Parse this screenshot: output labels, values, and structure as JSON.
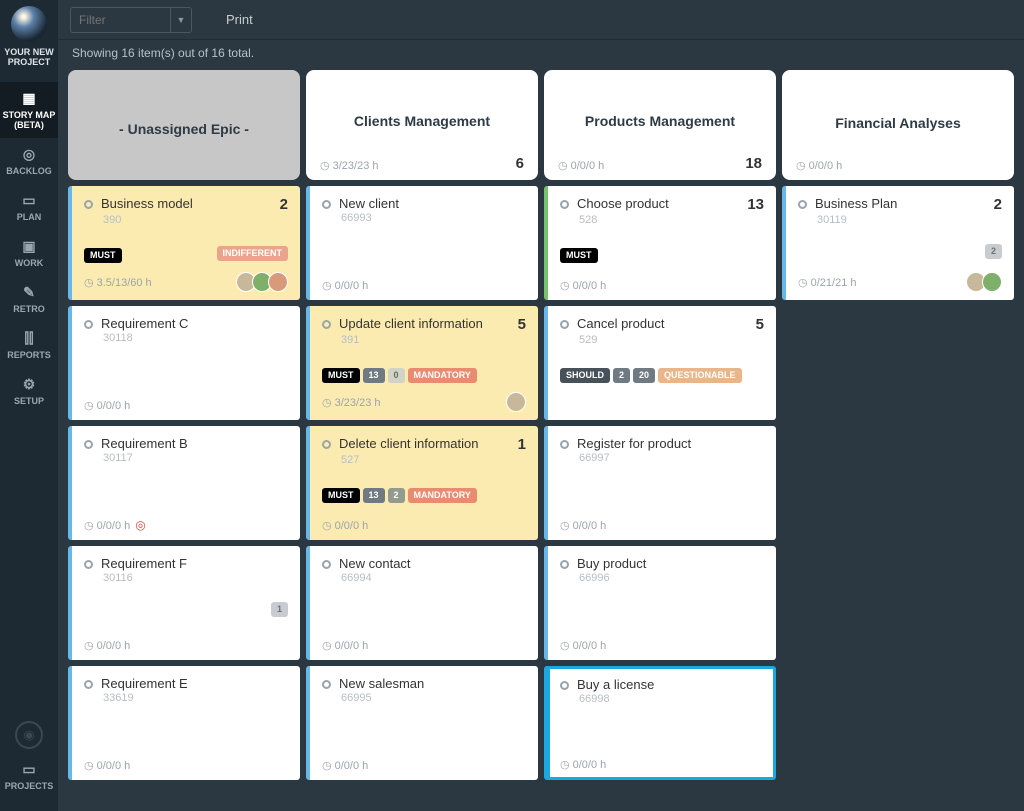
{
  "project_title": "YOUR NEW PROJECT",
  "nav": [
    {
      "icon": "▦",
      "label": "STORY MAP (BETA)",
      "active": true
    },
    {
      "icon": "◎",
      "label": "BACKLOG"
    },
    {
      "icon": "▭",
      "label": "PLAN"
    },
    {
      "icon": "▣",
      "label": "WORK"
    },
    {
      "icon": "✎",
      "label": "RETRO"
    },
    {
      "icon": "⫿⫿",
      "label": "REPORTS"
    },
    {
      "icon": "⚙",
      "label": "SETUP"
    }
  ],
  "projects_label": "PROJECTS",
  "toolbar": {
    "filter_placeholder": "Filter",
    "print": "Print"
  },
  "status": "Showing 16 item(s) out of 16 total.",
  "epics": [
    {
      "title": "- Unassigned Epic -",
      "unassigned": true
    },
    {
      "title": "Clients Management",
      "time": "3/23/23 h",
      "count": "6"
    },
    {
      "title": "Products Management",
      "time": "0/0/0 h",
      "count": "18"
    },
    {
      "title": "Financial Analyses",
      "time": "0/0/0 h"
    }
  ],
  "rows": [
    [
      {
        "title": "Business model",
        "id": "390",
        "points": "2",
        "yellow": true,
        "red": true,
        "tags": [
          {
            "t": "MUST",
            "c": "tag-must"
          }
        ],
        "right_tag": {
          "t": "INDIFFERENT",
          "c": "tag-indiff"
        },
        "time": "3.5/13/60 h",
        "avatars": 3
      },
      {
        "title": "New client",
        "id": "66993",
        "time": "0/0/0 h"
      },
      {
        "title": "Choose product",
        "id": "528",
        "points": "13",
        "green": true,
        "tags": [
          {
            "t": "MUST",
            "c": "tag-must"
          }
        ],
        "time": "0/0/0 h"
      },
      {
        "title": "Business Plan",
        "id": "30119",
        "points": "2",
        "right_tag": {
          "t": "2",
          "c": "tag-grey"
        },
        "time": "0/21/21 h",
        "avatars": 2
      }
    ],
    [
      {
        "title": "Requirement C",
        "id": "30118",
        "time": "0/0/0 h"
      },
      {
        "title": "Update client information",
        "id": "391",
        "points": "5",
        "yellow": true,
        "tags": [
          {
            "t": "MUST",
            "c": "tag-must"
          },
          {
            "t": "13",
            "c": "tag-num"
          },
          {
            "t": "0",
            "c": "tag-lightnum"
          },
          {
            "t": "MANDATORY",
            "c": "tag-mandatory"
          }
        ],
        "time": "3/23/23 h",
        "avatars": 1
      },
      {
        "title": "Cancel product",
        "id": "529",
        "points": "5",
        "tags": [
          {
            "t": "SHOULD",
            "c": "tag-should"
          },
          {
            "t": "2",
            "c": "tag-num"
          },
          {
            "t": "20",
            "c": "tag-num"
          },
          {
            "t": "QUESTIONABLE",
            "c": "tag-quest"
          }
        ],
        "time": ""
      },
      null
    ],
    [
      {
        "title": "Requirement B",
        "id": "30117",
        "time": "0/0/0 h",
        "red_foot": true
      },
      {
        "title": "Delete client information",
        "id": "527",
        "points": "1",
        "yellow": true,
        "tags": [
          {
            "t": "MUST",
            "c": "tag-must"
          },
          {
            "t": "13",
            "c": "tag-num"
          },
          {
            "t": "2",
            "c": "tag-num2"
          },
          {
            "t": "MANDATORY",
            "c": "tag-mandatory"
          }
        ],
        "time": "0/0/0 h"
      },
      {
        "title": "Register for product",
        "id": "66997",
        "time": "0/0/0 h"
      },
      null
    ],
    [
      {
        "title": "Requirement F",
        "id": "30116",
        "right_tag": {
          "t": "1",
          "c": "tag-grey"
        },
        "time": "0/0/0 h"
      },
      {
        "title": "New contact",
        "id": "66994",
        "time": "0/0/0 h"
      },
      {
        "title": "Buy product",
        "id": "66996",
        "time": "0/0/0 h"
      },
      null
    ],
    [
      {
        "title": "Requirement E",
        "id": "33619",
        "time": "0/0/0 h"
      },
      {
        "title": "New salesman",
        "id": "66995",
        "time": "0/0/0 h"
      },
      {
        "title": "Buy a license",
        "id": "66998",
        "time": "0/0/0 h",
        "selected": true
      },
      null
    ]
  ]
}
